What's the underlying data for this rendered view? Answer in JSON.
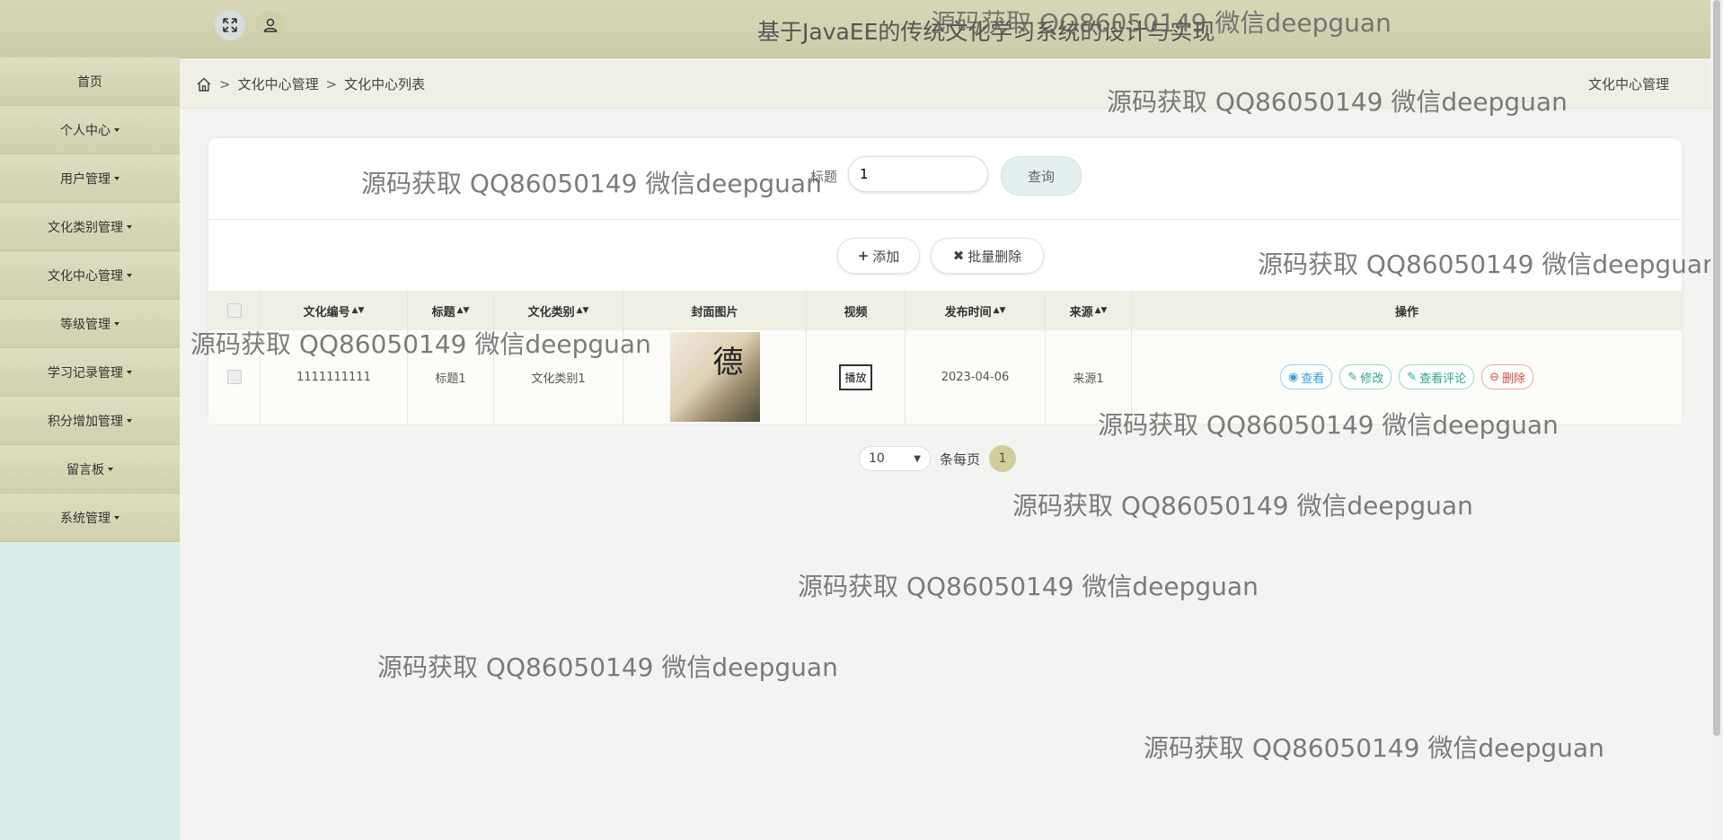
{
  "header": {
    "title": "基于JavaEE的传统文化学习系统的设计与实现",
    "fullscreen_icon": "expand-icon",
    "user_icon": "user-icon"
  },
  "sidebar": {
    "items": [
      {
        "label": "首页",
        "has_caret": false
      },
      {
        "label": "个人中心",
        "has_caret": true
      },
      {
        "label": "用户管理",
        "has_caret": true
      },
      {
        "label": "文化类别管理",
        "has_caret": true
      },
      {
        "label": "文化中心管理",
        "has_caret": true
      },
      {
        "label": "等级管理",
        "has_caret": true
      },
      {
        "label": "学习记录管理",
        "has_caret": true
      },
      {
        "label": "积分增加管理",
        "has_caret": true
      },
      {
        "label": "留言板",
        "has_caret": true
      },
      {
        "label": "系统管理",
        "has_caret": true
      }
    ]
  },
  "breadcrumb": {
    "items": [
      "文化中心管理",
      "文化中心列表"
    ],
    "separator": ">",
    "right_label": "文化中心管理"
  },
  "search": {
    "label": "标题",
    "value": "1",
    "button_label": "查询"
  },
  "actions": {
    "add_label": "添加",
    "batch_delete_label": "批量删除"
  },
  "table": {
    "headers": {
      "code": "文化编号",
      "title": "标题",
      "category": "文化类别",
      "cover": "封面图片",
      "video": "视频",
      "date": "发布时间",
      "source": "来源",
      "ops": "操作"
    },
    "rows": [
      {
        "code": "1111111111",
        "title": "标题1",
        "category": "文化类别1",
        "video_button": "播放",
        "date": "2023-04-06",
        "source": "来源1",
        "ops": {
          "view": "查看",
          "edit": "修改",
          "comments": "查看评论",
          "delete": "删除"
        }
      }
    ]
  },
  "pager": {
    "page_size": "10",
    "per_page_label": "条每页",
    "current_page": "1"
  },
  "watermark_text": "源码获取 QQ86050149 微信deepguan",
  "colors": {
    "header_bg": "#d4d4b2",
    "sidebar_item_bg": "#d8d8b8",
    "sidebar_bg": "#dcecea",
    "pager_active": "#cfcf9b"
  }
}
